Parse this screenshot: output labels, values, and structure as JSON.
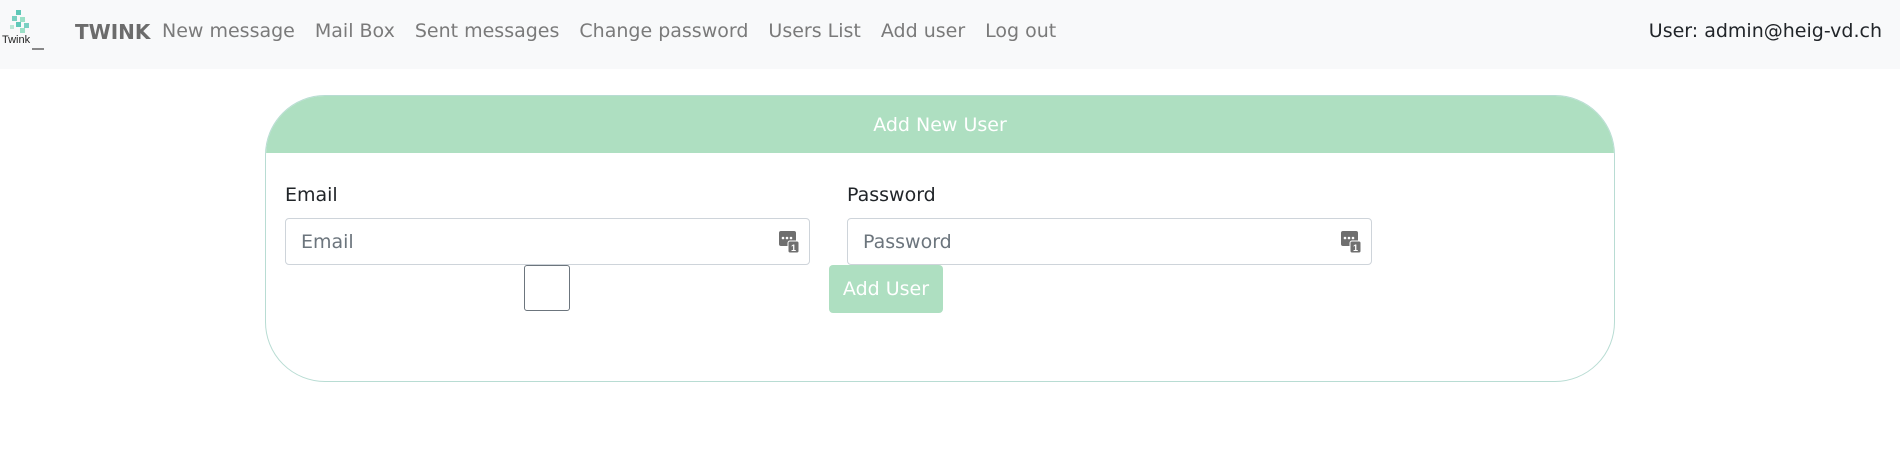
{
  "navbar": {
    "logo_text": "Twink",
    "brand": "TWINK",
    "links": [
      {
        "label": "New message"
      },
      {
        "label": "Mail Box"
      },
      {
        "label": "Sent messages"
      },
      {
        "label": "Change password"
      },
      {
        "label": "Users List"
      },
      {
        "label": "Add user"
      },
      {
        "label": "Log out"
      }
    ],
    "user_info": "User: admin@heig-vd.ch"
  },
  "card": {
    "title": "Add New User",
    "email": {
      "label": "Email",
      "placeholder": "Email",
      "value": ""
    },
    "password": {
      "label": "Password",
      "placeholder": "Password",
      "value": ""
    },
    "submit_label": "Add User"
  },
  "colors": {
    "accent": "#aedfc1",
    "navbar_bg": "#f8f9fa",
    "card_border": "#b8dcd3"
  }
}
